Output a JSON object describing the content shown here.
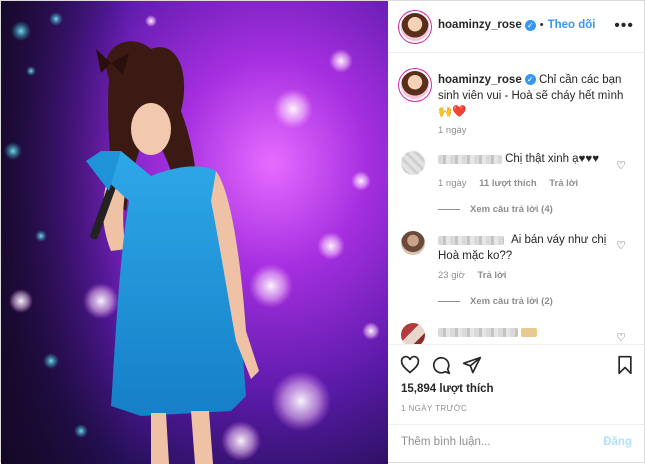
{
  "header": {
    "username": "hoaminzy_rose",
    "follow_label": "Theo dõi",
    "separator": "•",
    "more_label": "•••"
  },
  "caption": {
    "username": "hoaminzy_rose",
    "text": "Chỉ cần các bạn sinh viên vui - Hoà sẽ cháy hết mình",
    "emoji": "🙌❤️",
    "time": "1 ngày"
  },
  "comments": [
    {
      "text": "Chị thật xinh ạ♥♥♥",
      "time": "1 ngày",
      "likes": "11 lượt thích",
      "reply_label": "Trả lời",
      "view_replies": "Xem câu trả lời (4)"
    },
    {
      "text_line1": "Ai bán váy như chị",
      "text_line2": "Hoà mặc ko??",
      "time": "23 giờ",
      "reply_label": "Trả lời",
      "view_replies": "Xem câu trả lời (2)"
    }
  ],
  "actions": {
    "likes": "15,894 lượt thích",
    "timestamp": "1 NGÀY TRƯỚC"
  },
  "add_comment": {
    "placeholder": "Thêm bình luận...",
    "post_label": "Đăng"
  },
  "icons": [
    "heart-icon",
    "comment-icon",
    "share-icon",
    "bookmark-icon",
    "verified-icon",
    "more-icon"
  ],
  "colors": {
    "accent": "#3897f0",
    "text": "#262626",
    "muted": "#8e8e8e"
  }
}
